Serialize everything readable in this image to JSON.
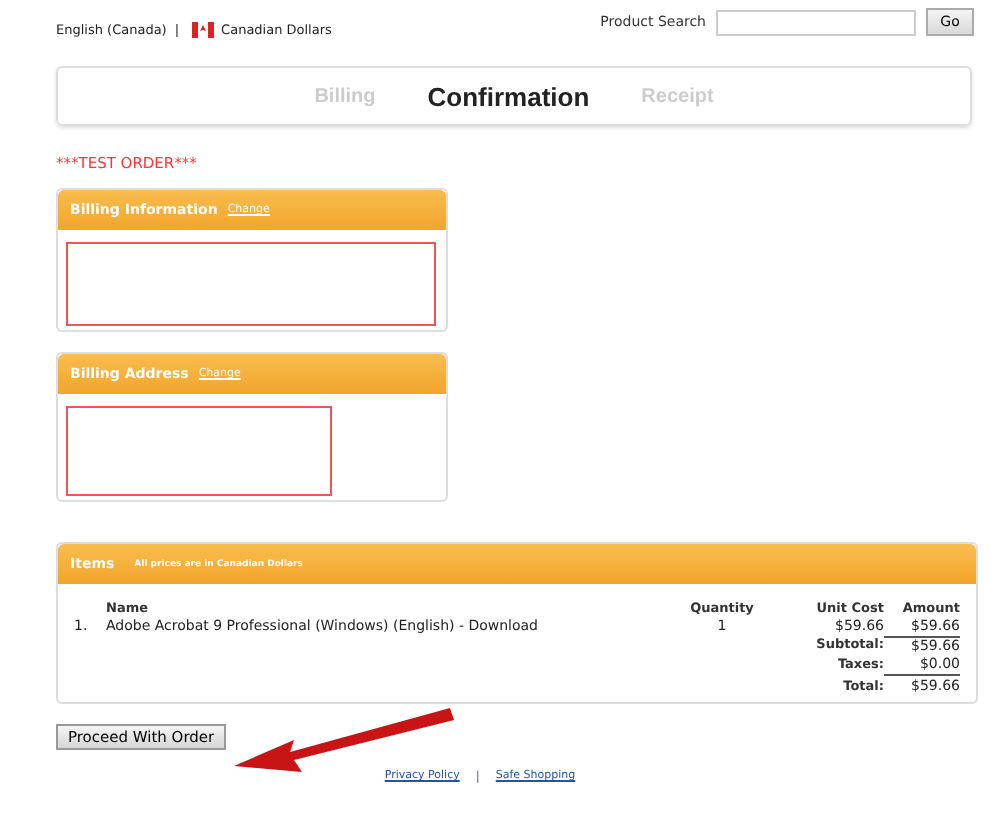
{
  "top_bar": {
    "language": "English (Canada)",
    "separator": "|",
    "currency": "Canadian Dollars",
    "search_label": "Product Search",
    "search_button": "Go"
  },
  "steps": [
    {
      "label": "Billing",
      "selected": false
    },
    {
      "label": "Confirmation",
      "selected": true
    },
    {
      "label": "Receipt",
      "selected": false
    }
  ],
  "notice": "***TEST ORDER***",
  "billing_information": {
    "title": "Billing Information",
    "link": "Change"
  },
  "billing_address": {
    "title": "Billing Address",
    "link": "Change"
  },
  "items": {
    "title": "Items",
    "note": "All prices are in Canadian Dollars",
    "columns": [
      "Name",
      "Quantity",
      "Unit Cost",
      "Amount"
    ],
    "rows": [
      {
        "number": "1.",
        "name": "Adobe Acrobat 9 Professional (Windows) (English) - Download",
        "quantity": "1",
        "unit_cost": "$59.66",
        "amount": "$59.66"
      }
    ],
    "totals": [
      {
        "label": "Subtotal:",
        "value": "$59.66"
      },
      {
        "label": "Taxes:",
        "value": "$0.00"
      },
      {
        "label": "Total:",
        "value": "$59.66"
      }
    ]
  },
  "proceed_button": "Proceed With Order",
  "footer": {
    "links": [
      "Privacy Policy",
      "Safe Shopping"
    ],
    "separator": "|"
  }
}
